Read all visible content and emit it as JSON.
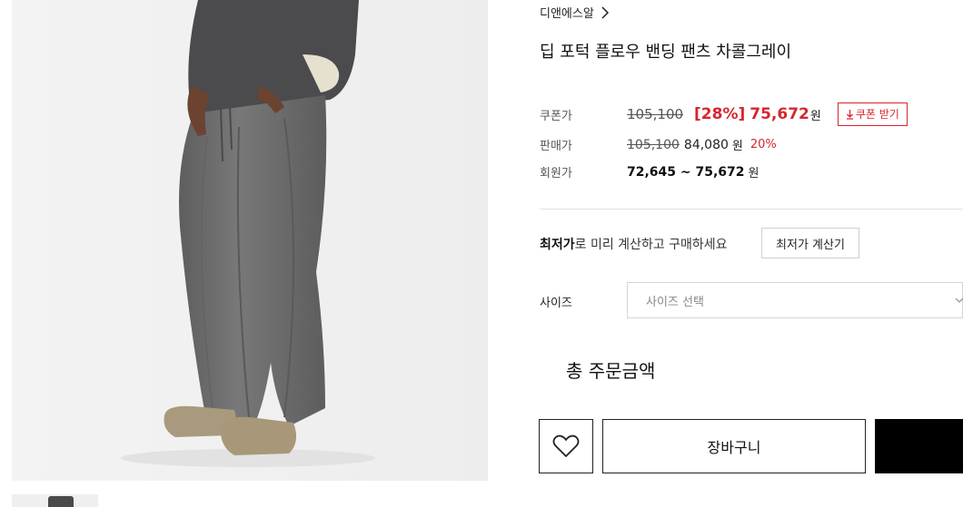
{
  "brand": {
    "name": "디앤에스알"
  },
  "product": {
    "title": "딥 포턱 플로우 밴딩 팬츠 차콜그레이"
  },
  "coupon": {
    "label": "쿠폰가",
    "original_price": "105,100",
    "discount_rate": "[28%]",
    "price": "75,672",
    "currency": "원",
    "button_label": "쿠폰 받기",
    "button_icon": "download-arrow-icon"
  },
  "sale": {
    "label": "판매가",
    "original_price": "105,100",
    "price": "84,080",
    "currency": "원",
    "discount_rate": "20%"
  },
  "member": {
    "label": "회원가",
    "price_range": "72,645 ~ 75,672",
    "currency": "원"
  },
  "lowest_price": {
    "bold_text": "최저가",
    "text": "로 미리 계산하고 구매하세요",
    "button_label": "최저가 계산기"
  },
  "size": {
    "label": "사이즈",
    "placeholder": "사이즈 선택"
  },
  "total": {
    "label": "총 주문금액"
  },
  "actions": {
    "wish_icon": "heart-icon",
    "cart_label": "장바구니",
    "buy_label": ""
  },
  "colors": {
    "accent_red": "#d6262f",
    "buy_button": "#000000",
    "pants": "#6f6f6f",
    "sweater": "#4b4a4d"
  }
}
